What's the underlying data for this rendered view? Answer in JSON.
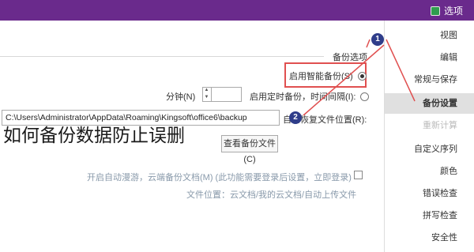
{
  "titlebar": {
    "title": "选项",
    "icon": "app-icon"
  },
  "backup_group": {
    "title": "备份选项",
    "option_smart": "启用智能备份(S)",
    "option_timed": "启用定时备份，时间间隔(I):",
    "unit_minutes": "分钟(N)",
    "path_label": "自动恢复文件位置(R):",
    "path_value": "C:\\Users\\Administrator\\AppData\\Roaming\\Kingsoft\\office6\\backup",
    "view_backup_button": "查看备份文件(C)",
    "cloud_option": "开启自动漫游，云端备份文档(M) (此功能需要登录后设置，立即登录)",
    "file_location_note": "文件位置：云文档/我的云文档/自动上传文件"
  },
  "markers": {
    "marker_1": "1",
    "marker_2": "2"
  },
  "overlay_caption": "如何备份数据防止误删",
  "sidebar": {
    "items": [
      {
        "label": "视图"
      },
      {
        "label": "编辑"
      },
      {
        "label": "常规与保存"
      },
      {
        "label": "备份设置"
      },
      {
        "label": "重新计算"
      },
      {
        "label": "自定义序列"
      },
      {
        "label": "颜色"
      },
      {
        "label": "错误检查"
      },
      {
        "label": "拼写检查"
      },
      {
        "label": "安全性"
      }
    ],
    "active_index": 3
  },
  "colors": {
    "titlebar": "#6a2a8c",
    "highlight": "#e05050",
    "marker": "#2f3d8a"
  }
}
